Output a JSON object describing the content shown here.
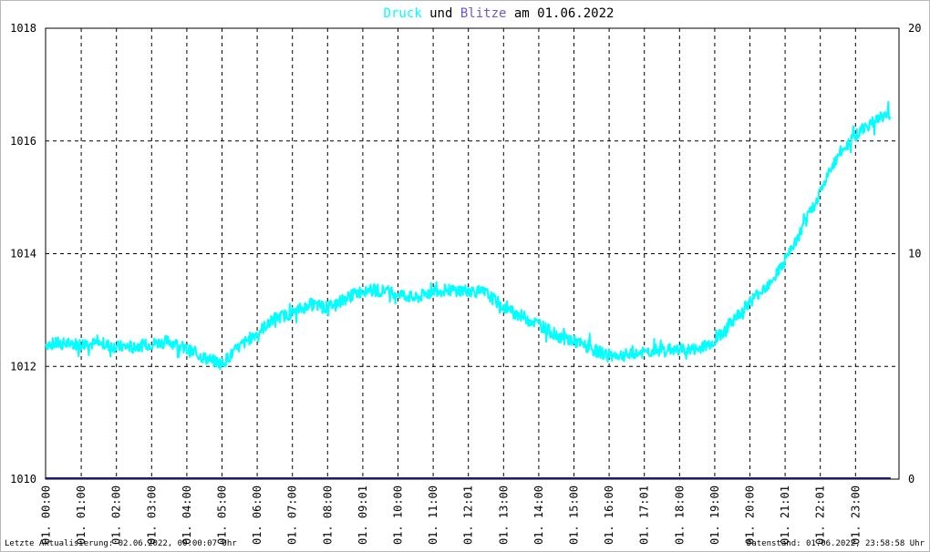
{
  "chart_data": {
    "type": "line",
    "title_parts": {
      "series1": "Druck",
      "connector": "und",
      "series2": "Blitze",
      "date_part": "am 01.06.2022"
    },
    "y_left_ticks": [
      "1010",
      "1012",
      "1014",
      "1016",
      "1018"
    ],
    "y_right_ticks": [
      "0",
      "10",
      "20"
    ],
    "ylim_left": [
      1010,
      1018
    ],
    "ylim_right": [
      0,
      20
    ],
    "x_ticks": [
      "01. 00:00",
      "01. 01:00",
      "01. 02:00",
      "01. 03:00",
      "01. 04:00",
      "01. 05:00",
      "01. 06:00",
      "01. 07:00",
      "01. 08:00",
      "01. 09:01",
      "01. 10:00",
      "01. 11:00",
      "01. 12:01",
      "01. 13:00",
      "01. 14:00",
      "01. 15:00",
      "01. 16:00",
      "01. 17:01",
      "01. 18:00",
      "01. 19:00",
      "01. 20:00",
      "01. 21:01",
      "01. 22:01",
      "01. 23:00"
    ],
    "grid": true,
    "colors": {
      "druck": "#00ffff",
      "blitze": "#6a5acd",
      "baseline": "#1c1c6e"
    },
    "series": [
      {
        "name": "Druck",
        "axis": "left",
        "x_hours": [
          0,
          0.5,
          1,
          1.5,
          2,
          2.5,
          3,
          3.5,
          4,
          4.5,
          5,
          5.5,
          6,
          6.5,
          7,
          7.5,
          8,
          8.5,
          9,
          9.5,
          10,
          10.5,
          11,
          11.5,
          12,
          12.5,
          13,
          13.5,
          14,
          14.5,
          15,
          15.5,
          16,
          16.5,
          17,
          17.5,
          18,
          18.5,
          19,
          19.5,
          20,
          20.5,
          21,
          21.5,
          22,
          22.5,
          23,
          23.5,
          24
        ],
        "values": [
          1012.4,
          1012.4,
          1012.4,
          1012.4,
          1012.35,
          1012.35,
          1012.4,
          1012.45,
          1012.3,
          1012.15,
          1012.05,
          1012.35,
          1012.6,
          1012.85,
          1012.95,
          1013.1,
          1013.05,
          1013.2,
          1013.35,
          1013.35,
          1013.3,
          1013.2,
          1013.35,
          1013.35,
          1013.35,
          1013.3,
          1013.05,
          1012.9,
          1012.75,
          1012.55,
          1012.45,
          1012.3,
          1012.2,
          1012.2,
          1012.25,
          1012.3,
          1012.3,
          1012.3,
          1012.45,
          1012.8,
          1013.15,
          1013.45,
          1013.85,
          1014.45,
          1015.1,
          1015.75,
          1016.1,
          1016.35,
          1016.5
        ]
      },
      {
        "name": "Blitze",
        "axis": "right",
        "x_hours": [
          0,
          24
        ],
        "values": [
          0,
          0
        ]
      }
    ]
  },
  "footer": {
    "left": "Letzte Aktualisierung: 02.06.2022, 00:00:07 Uhr",
    "right": "Datenstand: 01.06.2022, 23:58:58 Uhr"
  }
}
